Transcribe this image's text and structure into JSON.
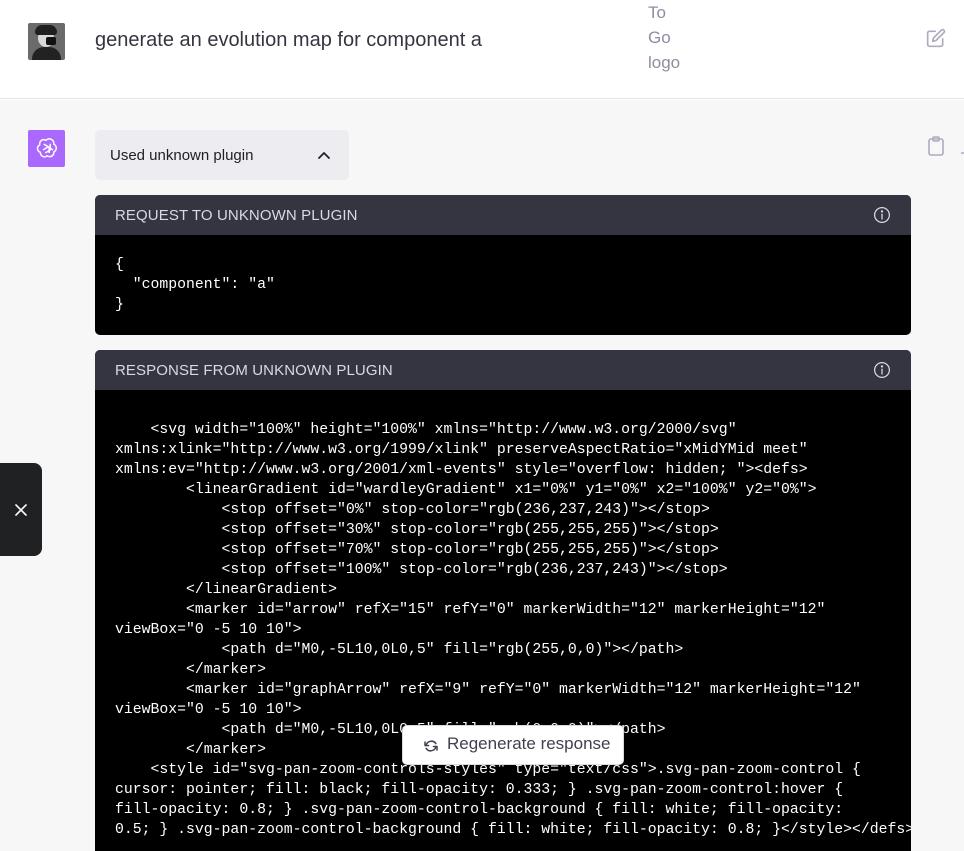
{
  "user_message": {
    "text": "generate an evolution map for component a",
    "logo_alt_text": "To Go logo"
  },
  "assistant": {
    "plugin_toggle_label": "Used unknown plugin",
    "request_panel": {
      "title": "REQUEST TO UNKNOWN PLUGIN",
      "code": "{\n  \"component\": \"a\"\n}"
    },
    "response_panel": {
      "title": "RESPONSE FROM UNKNOWN PLUGIN",
      "code": "    <svg width=\"100%\" height=\"100%\" xmlns=\"http://www.w3.org/2000/svg\"\nxmlns:xlink=\"http://www.w3.org/1999/xlink\" preserveAspectRatio=\"xMidYMid meet\"\nxmlns:ev=\"http://www.w3.org/2001/xml-events\" style=\"overflow: hidden; \"><defs>\n        <linearGradient id=\"wardleyGradient\" x1=\"0%\" y1=\"0%\" x2=\"100%\" y2=\"0%\">\n            <stop offset=\"0%\" stop-color=\"rgb(236,237,243)\"></stop>\n            <stop offset=\"30%\" stop-color=\"rgb(255,255,255)\"></stop>\n            <stop offset=\"70%\" stop-color=\"rgb(255,255,255)\"></stop>\n            <stop offset=\"100%\" stop-color=\"rgb(236,237,243)\"></stop>\n        </linearGradient>\n        <marker id=\"arrow\" refX=\"15\" refY=\"0\" markerWidth=\"12\" markerHeight=\"12\"\nviewBox=\"0 -5 10 10\">\n            <path d=\"M0,-5L10,0L0,5\" fill=\"rgb(255,0,0)\"></path>\n        </marker>\n        <marker id=\"graphArrow\" refX=\"9\" refY=\"0\" markerWidth=\"12\" markerHeight=\"12\"\nviewBox=\"0 -5 10 10\">\n            <path d=\"M0,-5L10,0L0,5\" fill=\"rgb(0,0,0)\"></path>\n        </marker>\n    <style id=\"svg-pan-zoom-controls-styles\" type=\"text/css\">.svg-pan-zoom-control {\ncursor: pointer; fill: black; fill-opacity: 0.333; } .svg-pan-zoom-control:hover {\nfill-opacity: 0.8; } .svg-pan-zoom-control-background { fill: white; fill-opacity:\n0.5; } .svg-pan-zoom-control-background { fill: white; fill-opacity: 0.8; }</style></defs><g"
    }
  },
  "regenerate_label": "Regenerate response",
  "colors": {
    "gpt_avatar": "#ab68ff",
    "panel_header": "#343541",
    "panel_body": "#000000",
    "assistant_bg": "#f7f7f8"
  },
  "icons": [
    "user-avatar",
    "edit-icon",
    "chatgpt-logo-icon",
    "clipboard-icon",
    "chevron-up-icon",
    "info-icon",
    "close-icon",
    "refresh-icon"
  ]
}
